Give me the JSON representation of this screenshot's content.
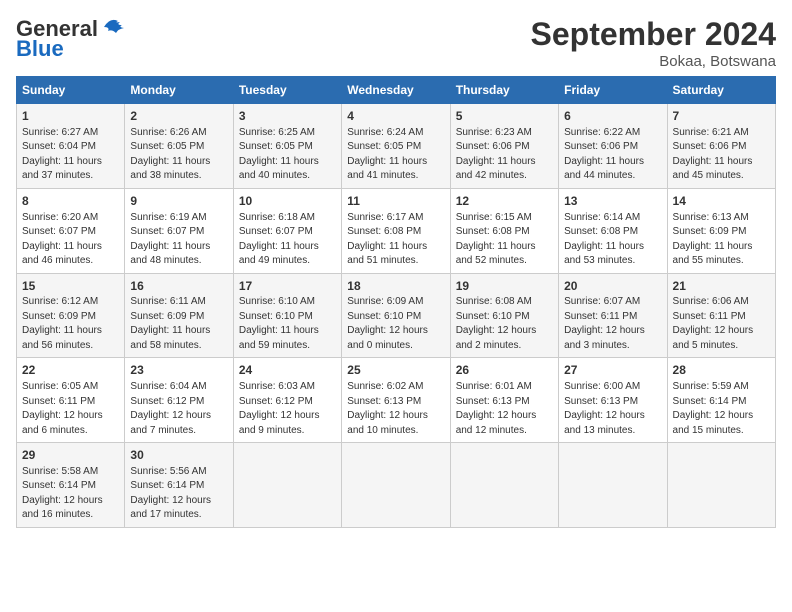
{
  "header": {
    "logo_general": "General",
    "logo_blue": "Blue",
    "title": "September 2024",
    "subtitle": "Bokaa, Botswana"
  },
  "weekdays": [
    "Sunday",
    "Monday",
    "Tuesday",
    "Wednesday",
    "Thursday",
    "Friday",
    "Saturday"
  ],
  "weeks": [
    [
      {
        "day": "1",
        "info": "Sunrise: 6:27 AM\nSunset: 6:04 PM\nDaylight: 11 hours\nand 37 minutes."
      },
      {
        "day": "2",
        "info": "Sunrise: 6:26 AM\nSunset: 6:05 PM\nDaylight: 11 hours\nand 38 minutes."
      },
      {
        "day": "3",
        "info": "Sunrise: 6:25 AM\nSunset: 6:05 PM\nDaylight: 11 hours\nand 40 minutes."
      },
      {
        "day": "4",
        "info": "Sunrise: 6:24 AM\nSunset: 6:05 PM\nDaylight: 11 hours\nand 41 minutes."
      },
      {
        "day": "5",
        "info": "Sunrise: 6:23 AM\nSunset: 6:06 PM\nDaylight: 11 hours\nand 42 minutes."
      },
      {
        "day": "6",
        "info": "Sunrise: 6:22 AM\nSunset: 6:06 PM\nDaylight: 11 hours\nand 44 minutes."
      },
      {
        "day": "7",
        "info": "Sunrise: 6:21 AM\nSunset: 6:06 PM\nDaylight: 11 hours\nand 45 minutes."
      }
    ],
    [
      {
        "day": "8",
        "info": "Sunrise: 6:20 AM\nSunset: 6:07 PM\nDaylight: 11 hours\nand 46 minutes."
      },
      {
        "day": "9",
        "info": "Sunrise: 6:19 AM\nSunset: 6:07 PM\nDaylight: 11 hours\nand 48 minutes."
      },
      {
        "day": "10",
        "info": "Sunrise: 6:18 AM\nSunset: 6:07 PM\nDaylight: 11 hours\nand 49 minutes."
      },
      {
        "day": "11",
        "info": "Sunrise: 6:17 AM\nSunset: 6:08 PM\nDaylight: 11 hours\nand 51 minutes."
      },
      {
        "day": "12",
        "info": "Sunrise: 6:15 AM\nSunset: 6:08 PM\nDaylight: 11 hours\nand 52 minutes."
      },
      {
        "day": "13",
        "info": "Sunrise: 6:14 AM\nSunset: 6:08 PM\nDaylight: 11 hours\nand 53 minutes."
      },
      {
        "day": "14",
        "info": "Sunrise: 6:13 AM\nSunset: 6:09 PM\nDaylight: 11 hours\nand 55 minutes."
      }
    ],
    [
      {
        "day": "15",
        "info": "Sunrise: 6:12 AM\nSunset: 6:09 PM\nDaylight: 11 hours\nand 56 minutes."
      },
      {
        "day": "16",
        "info": "Sunrise: 6:11 AM\nSunset: 6:09 PM\nDaylight: 11 hours\nand 58 minutes."
      },
      {
        "day": "17",
        "info": "Sunrise: 6:10 AM\nSunset: 6:10 PM\nDaylight: 11 hours\nand 59 minutes."
      },
      {
        "day": "18",
        "info": "Sunrise: 6:09 AM\nSunset: 6:10 PM\nDaylight: 12 hours\nand 0 minutes."
      },
      {
        "day": "19",
        "info": "Sunrise: 6:08 AM\nSunset: 6:10 PM\nDaylight: 12 hours\nand 2 minutes."
      },
      {
        "day": "20",
        "info": "Sunrise: 6:07 AM\nSunset: 6:11 PM\nDaylight: 12 hours\nand 3 minutes."
      },
      {
        "day": "21",
        "info": "Sunrise: 6:06 AM\nSunset: 6:11 PM\nDaylight: 12 hours\nand 5 minutes."
      }
    ],
    [
      {
        "day": "22",
        "info": "Sunrise: 6:05 AM\nSunset: 6:11 PM\nDaylight: 12 hours\nand 6 minutes."
      },
      {
        "day": "23",
        "info": "Sunrise: 6:04 AM\nSunset: 6:12 PM\nDaylight: 12 hours\nand 7 minutes."
      },
      {
        "day": "24",
        "info": "Sunrise: 6:03 AM\nSunset: 6:12 PM\nDaylight: 12 hours\nand 9 minutes."
      },
      {
        "day": "25",
        "info": "Sunrise: 6:02 AM\nSunset: 6:13 PM\nDaylight: 12 hours\nand 10 minutes."
      },
      {
        "day": "26",
        "info": "Sunrise: 6:01 AM\nSunset: 6:13 PM\nDaylight: 12 hours\nand 12 minutes."
      },
      {
        "day": "27",
        "info": "Sunrise: 6:00 AM\nSunset: 6:13 PM\nDaylight: 12 hours\nand 13 minutes."
      },
      {
        "day": "28",
        "info": "Sunrise: 5:59 AM\nSunset: 6:14 PM\nDaylight: 12 hours\nand 15 minutes."
      }
    ],
    [
      {
        "day": "29",
        "info": "Sunrise: 5:58 AM\nSunset: 6:14 PM\nDaylight: 12 hours\nand 16 minutes."
      },
      {
        "day": "30",
        "info": "Sunrise: 5:56 AM\nSunset: 6:14 PM\nDaylight: 12 hours\nand 17 minutes."
      },
      {
        "day": "",
        "info": ""
      },
      {
        "day": "",
        "info": ""
      },
      {
        "day": "",
        "info": ""
      },
      {
        "day": "",
        "info": ""
      },
      {
        "day": "",
        "info": ""
      }
    ]
  ]
}
